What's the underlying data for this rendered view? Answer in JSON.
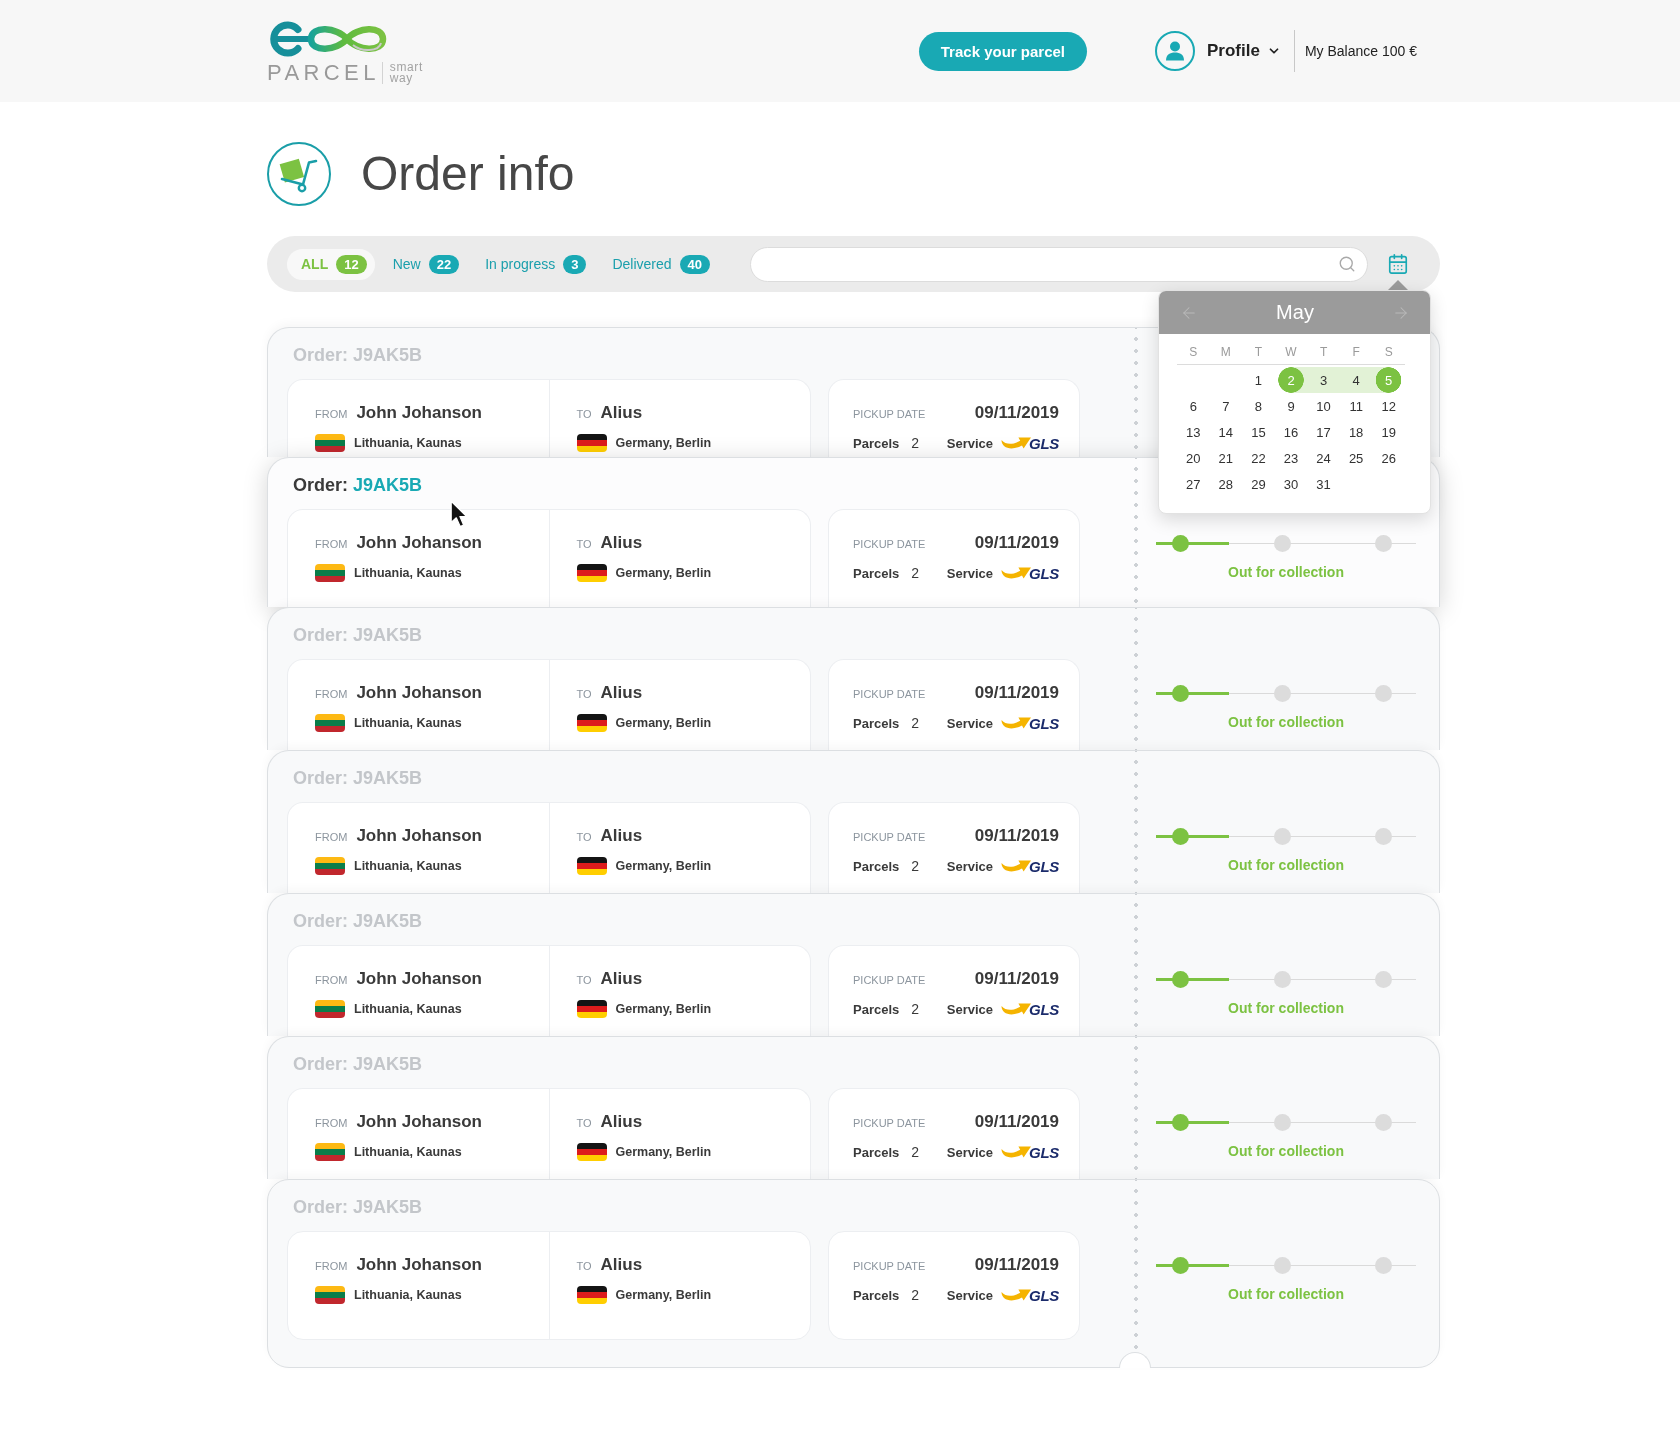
{
  "header": {
    "logo_word": "PARCEL",
    "logo_tagline": [
      "smart",
      "way"
    ],
    "track_button": "Track your parcel",
    "profile": "Profile",
    "balance": "My Balance 100 €"
  },
  "page_title": "Order info",
  "filters": [
    {
      "label": "ALL",
      "count": "12",
      "selected": true
    },
    {
      "label": "New",
      "count": "22",
      "selected": false
    },
    {
      "label": "In progress",
      "count": "3",
      "selected": false
    },
    {
      "label": "Delivered",
      "count": "40",
      "selected": false
    }
  ],
  "calendar": {
    "month": "May",
    "weekdays": [
      "S",
      "M",
      "T",
      "W",
      "T",
      "F",
      "S"
    ],
    "weeks": [
      [
        {
          "label": "1",
          "selected": false,
          "in_range": false
        },
        {
          "label": "2",
          "selected": true,
          "in_range": true
        },
        {
          "label": "3",
          "selected": false,
          "in_range": true
        },
        {
          "label": "4",
          "selected": false,
          "in_range": true
        },
        {
          "label": "5",
          "selected": true,
          "in_range": true
        }
      ],
      [
        {
          "label": "6",
          "selected": false,
          "in_range": false
        },
        {
          "label": "7",
          "selected": false,
          "in_range": false
        },
        {
          "label": "8",
          "selected": false,
          "in_range": false
        },
        {
          "label": "9",
          "selected": false,
          "in_range": false
        },
        {
          "label": "10",
          "selected": false,
          "in_range": false
        },
        {
          "label": "11",
          "selected": false,
          "in_range": false
        },
        {
          "label": "12",
          "selected": false,
          "in_range": false
        }
      ],
      [
        {
          "label": "13",
          "selected": false,
          "in_range": false
        },
        {
          "label": "14",
          "selected": false,
          "in_range": false
        },
        {
          "label": "15",
          "selected": false,
          "in_range": false
        },
        {
          "label": "16",
          "selected": false,
          "in_range": false
        },
        {
          "label": "17",
          "selected": false,
          "in_range": false
        },
        {
          "label": "18",
          "selected": false,
          "in_range": false
        },
        {
          "label": "19",
          "selected": false,
          "in_range": false
        }
      ],
      [
        {
          "label": "20",
          "selected": false,
          "in_range": false
        },
        {
          "label": "21",
          "selected": false,
          "in_range": false
        },
        {
          "label": "22",
          "selected": false,
          "in_range": false
        },
        {
          "label": "23",
          "selected": false,
          "in_range": false
        },
        {
          "label": "24",
          "selected": false,
          "in_range": false
        },
        {
          "label": "25",
          "selected": false,
          "in_range": false
        },
        {
          "label": "26",
          "selected": false,
          "in_range": false
        }
      ],
      [
        {
          "label": "27",
          "selected": false,
          "in_range": false
        },
        {
          "label": "28",
          "selected": false,
          "in_range": false
        },
        {
          "label": "29",
          "selected": false,
          "in_range": false
        },
        {
          "label": "30",
          "selected": false,
          "in_range": false
        },
        {
          "label": "31",
          "selected": false,
          "in_range": false
        }
      ]
    ]
  },
  "orders": [
    {
      "highlighted": false,
      "order_label": "Order:",
      "order_id": "J9AK5B",
      "from": {
        "label": "FROM",
        "name": "John Johanson",
        "place": "Lithuania, Kaunas",
        "flag": {
          "kind": "lithuania"
        }
      },
      "to": {
        "label": "TO",
        "name": "Alius",
        "place": "Germany, Berlin",
        "flag": {
          "kind": "germany"
        }
      },
      "pickup": {
        "label": "PICKUP DATE",
        "date": "09/11/2019"
      },
      "parcels": {
        "label": "Parcels",
        "count": "2"
      },
      "service": {
        "label": "Service",
        "logo_text": "GLS"
      }
    },
    {
      "highlighted": true,
      "order_label": "Order:",
      "order_id": "J9AK5B",
      "from": {
        "label": "FROM",
        "name": "John Johanson",
        "place": "Lithuania, Kaunas",
        "flag": {
          "kind": "lithuania"
        }
      },
      "to": {
        "label": "TO",
        "name": "Alius",
        "place": "Germany, Berlin",
        "flag": {
          "kind": "germany"
        }
      },
      "pickup": {
        "label": "PICKUP DATE",
        "date": "09/11/2019"
      },
      "parcels": {
        "label": "Parcels",
        "count": "2"
      },
      "service": {
        "label": "Service",
        "logo_text": "GLS"
      },
      "progress": {
        "level": 0.28,
        "steps": [
          {
            "done": true
          },
          {
            "done": false
          },
          {
            "done": false
          }
        ],
        "status": "Out for collection"
      }
    },
    {
      "highlighted": false,
      "order_label": "Order:",
      "order_id": "J9AK5B",
      "from": {
        "label": "FROM",
        "name": "John Johanson",
        "place": "Lithuania, Kaunas",
        "flag": {
          "kind": "lithuania"
        }
      },
      "to": {
        "label": "TO",
        "name": "Alius",
        "place": "Germany, Berlin",
        "flag": {
          "kind": "germany"
        }
      },
      "pickup": {
        "label": "PICKUP DATE",
        "date": "09/11/2019"
      },
      "parcels": {
        "label": "Parcels",
        "count": "2"
      },
      "service": {
        "label": "Service",
        "logo_text": "GLS"
      },
      "progress": {
        "level": 0.28,
        "steps": [
          {
            "done": true
          },
          {
            "done": false
          },
          {
            "done": false
          }
        ],
        "status": "Out for collection"
      }
    },
    {
      "highlighted": false,
      "order_label": "Order:",
      "order_id": "J9AK5B",
      "from": {
        "label": "FROM",
        "name": "John Johanson",
        "place": "Lithuania, Kaunas",
        "flag": {
          "kind": "lithuania"
        }
      },
      "to": {
        "label": "TO",
        "name": "Alius",
        "place": "Germany, Berlin",
        "flag": {
          "kind": "germany"
        }
      },
      "pickup": {
        "label": "PICKUP DATE",
        "date": "09/11/2019"
      },
      "parcels": {
        "label": "Parcels",
        "count": "2"
      },
      "service": {
        "label": "Service",
        "logo_text": "GLS"
      },
      "progress": {
        "level": 0.28,
        "steps": [
          {
            "done": true
          },
          {
            "done": false
          },
          {
            "done": false
          }
        ],
        "status": "Out for collection"
      }
    },
    {
      "highlighted": false,
      "order_label": "Order:",
      "order_id": "J9AK5B",
      "from": {
        "label": "FROM",
        "name": "John Johanson",
        "place": "Lithuania, Kaunas",
        "flag": {
          "kind": "lithuania"
        }
      },
      "to": {
        "label": "TO",
        "name": "Alius",
        "place": "Germany, Berlin",
        "flag": {
          "kind": "germany"
        }
      },
      "pickup": {
        "label": "PICKUP DATE",
        "date": "09/11/2019"
      },
      "parcels": {
        "label": "Parcels",
        "count": "2"
      },
      "service": {
        "label": "Service",
        "logo_text": "GLS"
      },
      "progress": {
        "level": 0.28,
        "steps": [
          {
            "done": true
          },
          {
            "done": false
          },
          {
            "done": false
          }
        ],
        "status": "Out for collection"
      }
    },
    {
      "highlighted": false,
      "order_label": "Order:",
      "order_id": "J9AK5B",
      "from": {
        "label": "FROM",
        "name": "John Johanson",
        "place": "Lithuania, Kaunas",
        "flag": {
          "kind": "lithuania"
        }
      },
      "to": {
        "label": "TO",
        "name": "Alius",
        "place": "Germany, Berlin",
        "flag": {
          "kind": "germany"
        }
      },
      "pickup": {
        "label": "PICKUP DATE",
        "date": "09/11/2019"
      },
      "parcels": {
        "label": "Parcels",
        "count": "2"
      },
      "service": {
        "label": "Service",
        "logo_text": "GLS"
      },
      "progress": {
        "level": 0.28,
        "steps": [
          {
            "done": true
          },
          {
            "done": false
          },
          {
            "done": false
          }
        ],
        "status": "Out for collection"
      }
    },
    {
      "highlighted": false,
      "order_label": "Order:",
      "order_id": "J9AK5B",
      "from": {
        "label": "FROM",
        "name": "John Johanson",
        "place": "Lithuania, Kaunas",
        "flag": {
          "kind": "lithuania"
        }
      },
      "to": {
        "label": "TO",
        "name": "Alius",
        "place": "Germany, Berlin",
        "flag": {
          "kind": "germany"
        }
      },
      "pickup": {
        "label": "PICKUP DATE",
        "date": "09/11/2019"
      },
      "parcels": {
        "label": "Parcels",
        "count": "2"
      },
      "service": {
        "label": "Service",
        "logo_text": "GLS"
      },
      "progress": {
        "level": 0.28,
        "steps": [
          {
            "done": true
          },
          {
            "done": false
          },
          {
            "done": false
          }
        ],
        "status": "Out for collection"
      }
    }
  ]
}
